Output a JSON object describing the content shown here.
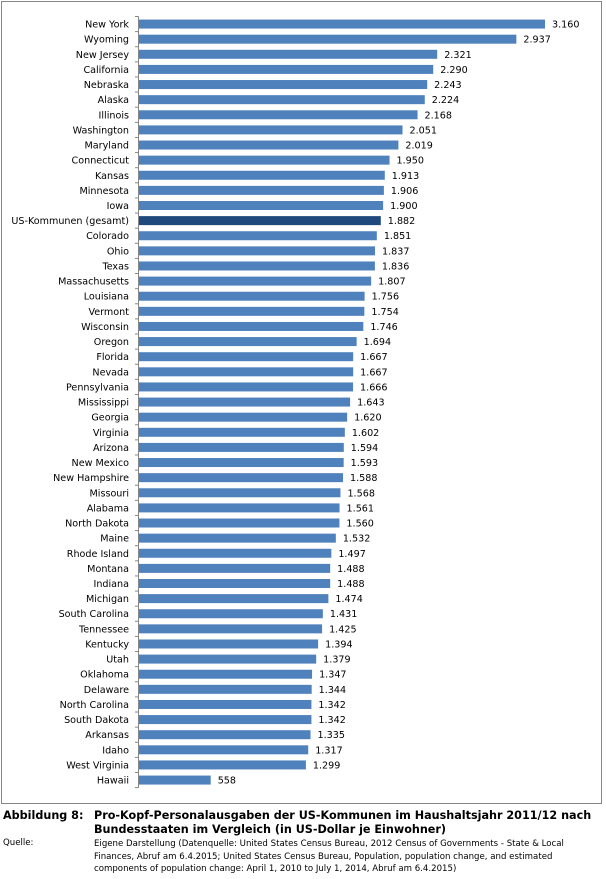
{
  "chart_data": {
    "type": "bar",
    "orientation": "horizontal",
    "title": "",
    "xlabel": "",
    "ylabel": "",
    "xlim": [
      0,
      3160
    ],
    "grid": false,
    "legend": "none",
    "value_format": "thousands-dot",
    "colors": {
      "default": "#4f81bd",
      "highlight": "#1f497d",
      "axis": "#868686"
    },
    "highlight_category": "US-Kommunen (gesamt)",
    "categories": [
      "New York",
      "Wyoming",
      "New Jersey",
      "California",
      "Nebraska",
      "Alaska",
      "Illinois",
      "Washington",
      "Maryland",
      "Connecticut",
      "Kansas",
      "Minnesota",
      "Iowa",
      "US-Kommunen (gesamt)",
      "Colorado",
      "Ohio",
      "Texas",
      "Massachusetts",
      "Louisiana",
      "Vermont",
      "Wisconsin",
      "Oregon",
      "Florida",
      "Nevada",
      "Pennsylvania",
      "Mississippi",
      "Georgia",
      "Virginia",
      "Arizona",
      "New Mexico",
      "New Hampshire",
      "Missouri",
      "Alabama",
      "North Dakota",
      "Maine",
      "Rhode Island",
      "Montana",
      "Indiana",
      "Michigan",
      "South Carolina",
      "Tennessee",
      "Kentucky",
      "Utah",
      "Oklahoma",
      "Delaware",
      "North Carolina",
      "South Dakota",
      "Arkansas",
      "Idaho",
      "West Virginia",
      "Hawaii"
    ],
    "values": [
      3160,
      2937,
      2321,
      2290,
      2243,
      2224,
      2168,
      2051,
      2019,
      1950,
      1913,
      1906,
      1900,
      1882,
      1851,
      1837,
      1836,
      1807,
      1756,
      1754,
      1746,
      1694,
      1667,
      1667,
      1666,
      1643,
      1620,
      1602,
      1594,
      1593,
      1588,
      1568,
      1561,
      1560,
      1532,
      1497,
      1488,
      1488,
      1474,
      1431,
      1425,
      1394,
      1379,
      1347,
      1344,
      1342,
      1342,
      1335,
      1317,
      1299,
      558
    ],
    "value_labels": [
      "3.160",
      "2.937",
      "2.321",
      "2.290",
      "2.243",
      "2.224",
      "2.168",
      "2.051",
      "2.019",
      "1.950",
      "1.913",
      "1.906",
      "1.900",
      "1.882",
      "1.851",
      "1.837",
      "1.836",
      "1.807",
      "1.756",
      "1.754",
      "1.746",
      "1.694",
      "1.667",
      "1.667",
      "1.666",
      "1.643",
      "1.620",
      "1.602",
      "1.594",
      "1.593",
      "1.588",
      "1.568",
      "1.561",
      "1.560",
      "1.532",
      "1.497",
      "1.488",
      "1.488",
      "1.474",
      "1.431",
      "1.425",
      "1.394",
      "1.379",
      "1.347",
      "1.344",
      "1.342",
      "1.342",
      "1.335",
      "1.317",
      "1.299",
      "558"
    ]
  },
  "caption": {
    "figure_label": "Abbildung 8:",
    "figure_title": "Pro-Kopf-Personalausgaben der US-Kommunen im Haushaltsjahr 2011/12 nach Bundesstaaten im Vergleich (in US-Dollar je Einwohner)",
    "source_label": "Quelle:",
    "source_text": "Eigene Darstellung (Datenquelle: United States Census Bureau, 2012 Census of Governments - State & Local Finances, Abruf am 6.4.2015;  United States Census Bureau, Population, population change, and estimated components of population change: April 1, 2010 to July 1, 2014, Abruf am 6.4.2015)"
  }
}
